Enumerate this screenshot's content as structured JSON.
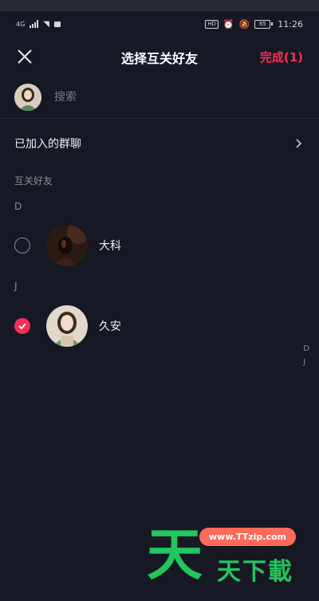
{
  "status_bar": {
    "network": "4G",
    "badges": [
      "HD"
    ],
    "battery": "85",
    "time": "11:26"
  },
  "nav": {
    "title": "选择互关好友",
    "done_label": "完成(1)"
  },
  "search": {
    "placeholder": "搜索"
  },
  "groups": {
    "label": "已加入的群聊"
  },
  "section": {
    "title": "互关好友"
  },
  "friends": [
    {
      "index_letter": "D",
      "name": "大科",
      "selected": false
    },
    {
      "index_letter": "J",
      "name": "久安",
      "selected": true
    }
  ],
  "side_index": [
    "D",
    "J"
  ],
  "watermark": {
    "big_char": "天",
    "url": "www.TTzip.com",
    "text": "天下載"
  },
  "colors": {
    "background": "#161823",
    "accent": "#fe2c55",
    "watermark_green": "#22c55e",
    "watermark_pill": "#ff6a5a"
  }
}
